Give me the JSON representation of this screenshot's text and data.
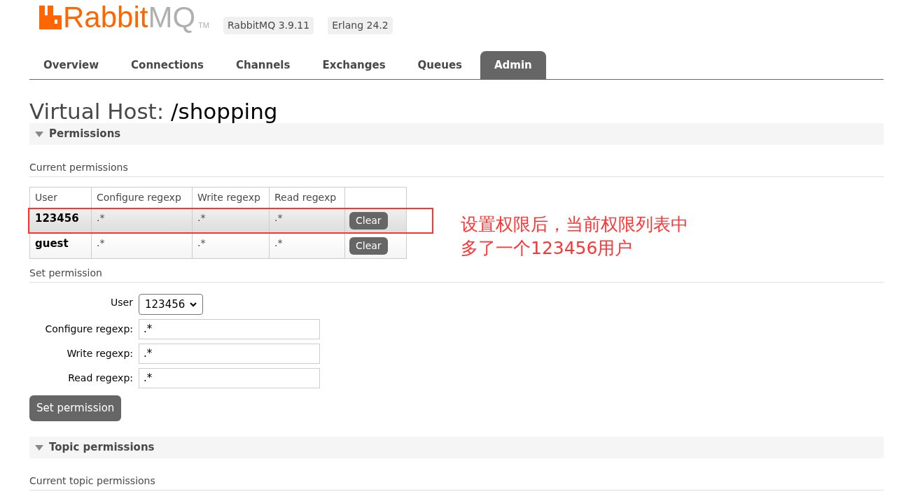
{
  "header": {
    "logo": {
      "part_1": "Rabbit",
      "part_2": "MQ",
      "trademark": "TM"
    },
    "badges": [
      "RabbitMQ 3.9.11",
      "Erlang 24.2"
    ]
  },
  "tabs": [
    {
      "label": "Overview",
      "selected": false
    },
    {
      "label": "Connections",
      "selected": false
    },
    {
      "label": "Channels",
      "selected": false
    },
    {
      "label": "Exchanges",
      "selected": false
    },
    {
      "label": "Queues",
      "selected": false
    },
    {
      "label": "Admin",
      "selected": true
    }
  ],
  "page_title": "Virtual Host: /shopping",
  "permissions": {
    "title": "Permissions",
    "expanded": true,
    "current_heading": "Current permissions",
    "table": {
      "columns": [
        "User",
        "Configure regexp",
        "Write regexp",
        "Read regexp"
      ],
      "rows": [
        {
          "user": "123456",
          "configure": ".*",
          "write": ".*",
          "read": ".*",
          "button": "Clear",
          "highlighted": true
        },
        {
          "user": "guest",
          "configure": ".*",
          "write": ".*",
          "read": ".*",
          "button": "Clear",
          "highlighted": false
        }
      ]
    },
    "set_heading": "Set permission",
    "form": {
      "user_label": "User",
      "user_value": "123456",
      "fields": [
        {
          "label": "Configure regexp:",
          "value": ".*"
        },
        {
          "label": "Write regexp:",
          "value": ".*"
        },
        {
          "label": "Read regexp:",
          "value": ".*"
        }
      ],
      "submit": "Set permission"
    }
  },
  "annotation": {
    "lines": [
      "设置权限后，当前权限列表中",
      "多了一个123456用户"
    ]
  },
  "topic_permissions": {
    "title": "Topic permissions",
    "expanded": true,
    "current_heading": "Current topic permissions"
  }
}
